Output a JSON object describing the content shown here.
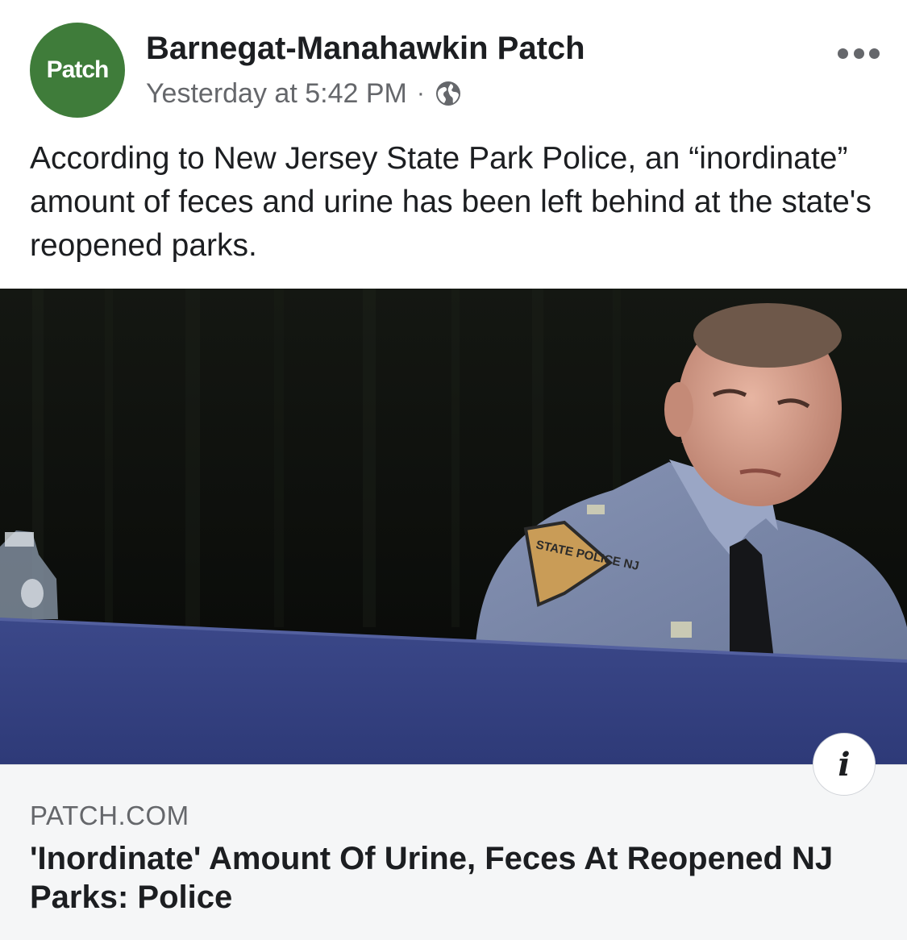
{
  "post": {
    "avatar_text": "Patch",
    "brand_color": "#3f7c3a",
    "page_name": "Barnegat-Manahawkin Patch",
    "timestamp": "Yesterday at 5:42 PM",
    "separator": "·",
    "privacy_icon": "globe-icon",
    "more_icon": "more-options-icon",
    "caption": "According to New Jersey State Park Police, an “inordinate” amount of feces and urine has been left behind at the state's reopened parks."
  },
  "link_preview": {
    "patch_text": "STATE POLICE NJ",
    "info_icon": "info-icon",
    "info_glyph": "i",
    "domain": "PATCH.COM",
    "headline": "'Inordinate' Amount Of Urine, Feces At Reopened NJ Parks: Police"
  }
}
